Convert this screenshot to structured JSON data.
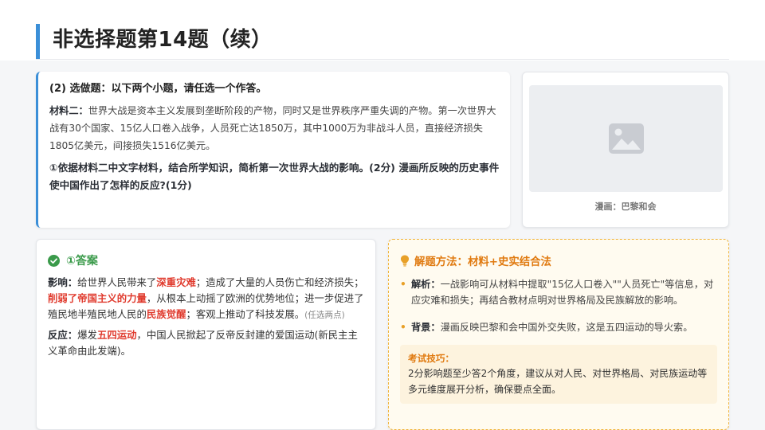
{
  "header": {
    "title": "非选择题第14题（续）"
  },
  "question": {
    "head": "(2) 选做题：以下两个小题，请任选一个作答。",
    "material_label": "材料二：",
    "material_text": "世界大战是资本主义发展到垄断阶段的产物，同时又是世界秩序严重失调的产物。第一次世界大战有30个国家、15亿人口卷入战争，人员死亡达1850万，其中1000万为非战斗人员，直接经济损失1805亿美元，间接损失1516亿美元。",
    "ask": "①依据材料二中文字材料，结合所学知识，简析第一次世界大战的影响。(2分) 漫画所反映的历史事件使中国作出了怎样的反应?(1分)"
  },
  "image": {
    "icon": "image-placeholder-icon",
    "caption": "漫画：巴黎和会"
  },
  "answer": {
    "title": "①答案",
    "impact_label": "影响：",
    "impact_t1": "给世界人民带来了",
    "impact_r1": "深重灾难",
    "impact_t2": "；造成了大量的人员伤亡和经济损失；",
    "impact_r2": "削弱了帝国主义的力量",
    "impact_t3": "，从根本上动摇了欧洲的优势地位；进一步促进了殖民地半殖民地人民的",
    "impact_r3": "民族觉醒",
    "impact_t4": "；客观上推动了科技发展。",
    "impact_hint": "(任选两点)",
    "reaction_label": "反应：",
    "reaction_t1": "爆发",
    "reaction_r1": "五四运动",
    "reaction_t2": "，中国人民掀起了反帝反封建的爱国运动(新民主主义革命由此发端)。"
  },
  "method": {
    "title": "解题方法：材料+史实结合法",
    "analysis_label": "解析：",
    "analysis_text": "一战影响可从材料中提取\"15亿人口卷入\"\"人员死亡\"等信息，对应灾难和损失；再结合教材点明对世界格局及民族解放的影响。",
    "background_label": "背景：",
    "background_text": "漫画反映巴黎和会中国外交失败，这是五四运动的导火索。",
    "tips_label": "考试技巧：",
    "tips_text": "2分影响题至少答2个角度，建议从对人民、对世界格局、对民族运动等多元维度展开分析，确保要点全面。"
  },
  "colors": {
    "accent": "#3b8fd8",
    "green": "#3a9a4a",
    "red": "#e03b2e",
    "orange": "#e07a10"
  }
}
